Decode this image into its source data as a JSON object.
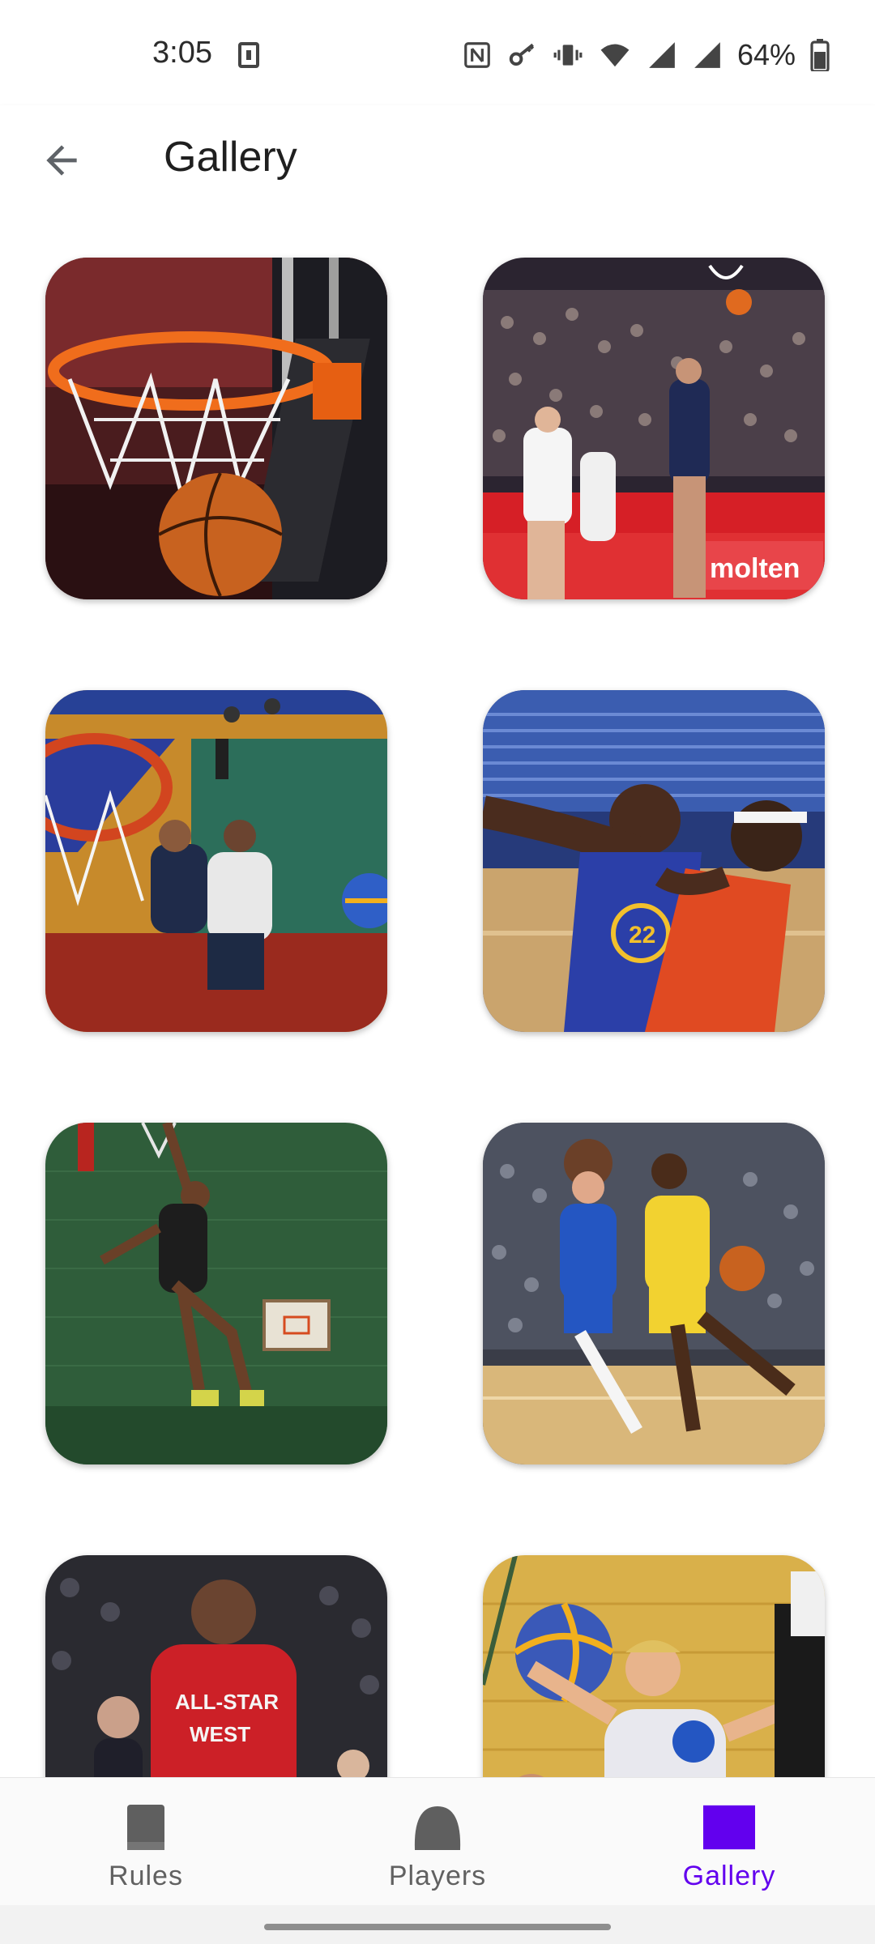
{
  "status_bar": {
    "time": "3:05",
    "battery": "64%",
    "icons": [
      "sim-card-icon",
      "nfc-icon",
      "key-icon",
      "vibrate-icon",
      "wifi-icon",
      "signal-icon",
      "signal-icon",
      "battery-icon"
    ]
  },
  "app_bar": {
    "title": "Gallery",
    "back_icon": "arrow-back-icon"
  },
  "gallery": {
    "images": [
      {
        "id": "basketball-hoop-photo"
      },
      {
        "id": "player-layup-photo"
      },
      {
        "id": "streetball-aerial-photo"
      },
      {
        "id": "warriors-player-photo"
      },
      {
        "id": "dunk-green-wall-photo"
      },
      {
        "id": "lions-player-photo"
      },
      {
        "id": "all-star-photo"
      },
      {
        "id": "diving-player-photo"
      }
    ]
  },
  "bottom_nav": {
    "items": [
      {
        "label": "Rules",
        "icon": "book-icon",
        "active": false
      },
      {
        "label": "Players",
        "icon": "basketball-icon",
        "active": false
      },
      {
        "label": "Gallery",
        "icon": "gallery-icon",
        "active": true
      }
    ]
  },
  "colors": {
    "accent": "#6200ee",
    "inactive": "#616161"
  }
}
